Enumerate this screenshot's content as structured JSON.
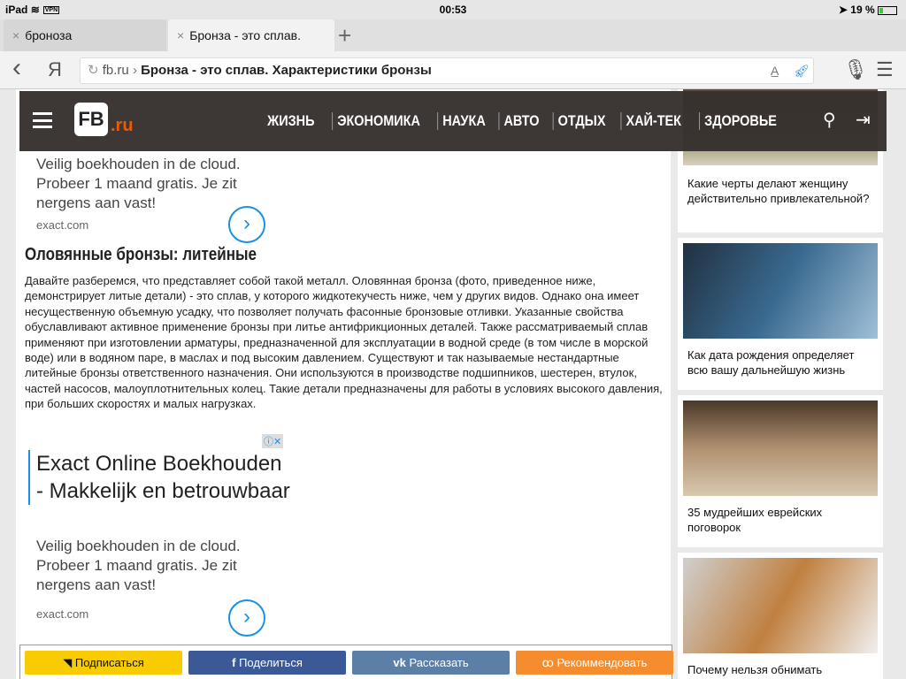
{
  "status": {
    "device": "iPad",
    "vpn": "VPN",
    "time": "00:53",
    "battery": "19 %"
  },
  "tabs": [
    {
      "label": "броноза"
    },
    {
      "label": "Бронза - это сплав."
    }
  ],
  "toolbar": {
    "back": "‹",
    "yandex": "Я",
    "domain": "fb.ru",
    "sep": "›",
    "title": "Бронза - это сплав. Характеристики бронзы"
  },
  "header": {
    "logo": "FB",
    "logo_suffix": ".ru",
    "nav": [
      "ЖИЗНЬ",
      "ЭКОНОМИКА",
      "НАУКА",
      "АВТО",
      "ОТДЫХ",
      "ХАЙ-ТЕК",
      "ЗДОРОВЬЕ"
    ]
  },
  "ad1": {
    "desc": "Veilig boekhouden in de cloud. Probeer 1 maand gratis. Je zit nergens aan vast!",
    "domain": "exact.com"
  },
  "article": {
    "heading": "Оловянные бронзы: литейные",
    "text": "Давайте разберемся, что представляет собой такой металл. Оловянная бронза (фото, приведенное ниже, демонстрирует литые детали) - это сплав, у которого жидкотекучесть ниже, чем у других видов. Однако она имеет несущественную объемную усадку, что позволяет получать фасонные бронзовые отливки. Указанные свойства обуславливают активное применение бронзы при литье антифрикционных деталей. Также рассматриваемый сплав применяют при изготовлении арматуры, предназначенной для эксплуатации в водной среде (в том числе в морской воде) или в водяном паре, в маслах и под высоким давлением. Существуют и так называемые нестандартные литейные бронзы ответственного назначения. Они используются в производстве подшипников, шестерен, втулок, частей насосов, малоуплотнительных колец. Такие детали предназначены для работы в условиях высокого давления, при больших скоростях и малых нагрузках."
  },
  "ad2": {
    "title": "Exact Online Boekhouden - Makkelijk en betrouwbaar",
    "desc": "Veilig boekhouden in de cloud. Probeer 1 maand gratis. Je zit nergens aan vast!",
    "domain": "exact.com"
  },
  "share": [
    {
      "label": "Подписаться",
      "color": "#f8cc00"
    },
    {
      "label": "Поделиться",
      "color": "#3b5897"
    },
    {
      "label": "Рассказать",
      "color": "#5b7fa6"
    },
    {
      "label": "Рекоммендовать",
      "color": "#f58c2e"
    }
  ],
  "sidebar": [
    {
      "caption": "Какие черты делают женщину действительно привлекательной?"
    },
    {
      "caption": "Как дата рождения определяет всю вашу дальнейшую жизнь"
    },
    {
      "caption": "35 мудрейших еврейских поговорок"
    },
    {
      "caption": "Почему нельзя обнимать"
    }
  ]
}
